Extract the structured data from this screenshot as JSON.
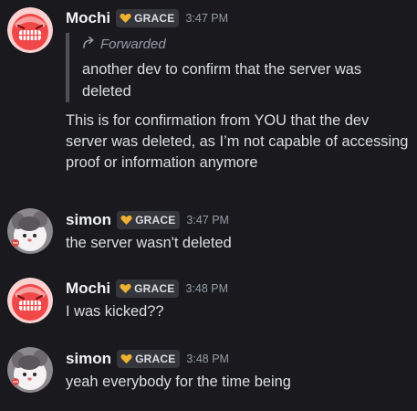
{
  "messages": [
    {
      "author": "Mochi",
      "tag": "GRACE",
      "timestamp": "3:47 PM",
      "avatar": "mochi-avatar",
      "forward_label": "Forwarded",
      "forward_text": "another dev to confirm that the server was deleted",
      "text": "This is for confirmation from YOU that the dev server was deleted, as I’m not capable of accessing proof or information anymore"
    },
    {
      "author": "simon",
      "tag": "GRACE",
      "timestamp": "3:47 PM",
      "avatar": "simon-avatar",
      "text": "the server wasn't deleted"
    },
    {
      "author": "Mochi",
      "tag": "GRACE",
      "timestamp": "3:48 PM",
      "avatar": "mochi-avatar",
      "text": "I was kicked??"
    },
    {
      "author": "simon",
      "tag": "GRACE",
      "timestamp": "3:48 PM",
      "avatar": "simon-avatar",
      "text": "yeah everybody for the time being"
    }
  ],
  "colors": {
    "background": "#1a1a1e",
    "text": "#dbdee1",
    "username": "#f2f3f5",
    "muted": "#949ba4",
    "tag_bg": "#35363c",
    "tag_heart": "#f0b232",
    "mochi_avatar_bg": "#f8a3a4",
    "mochi_face": "#f04848"
  },
  "icons": {
    "tag": "heart-badge-icon",
    "forward": "forward-arrow-icon"
  }
}
